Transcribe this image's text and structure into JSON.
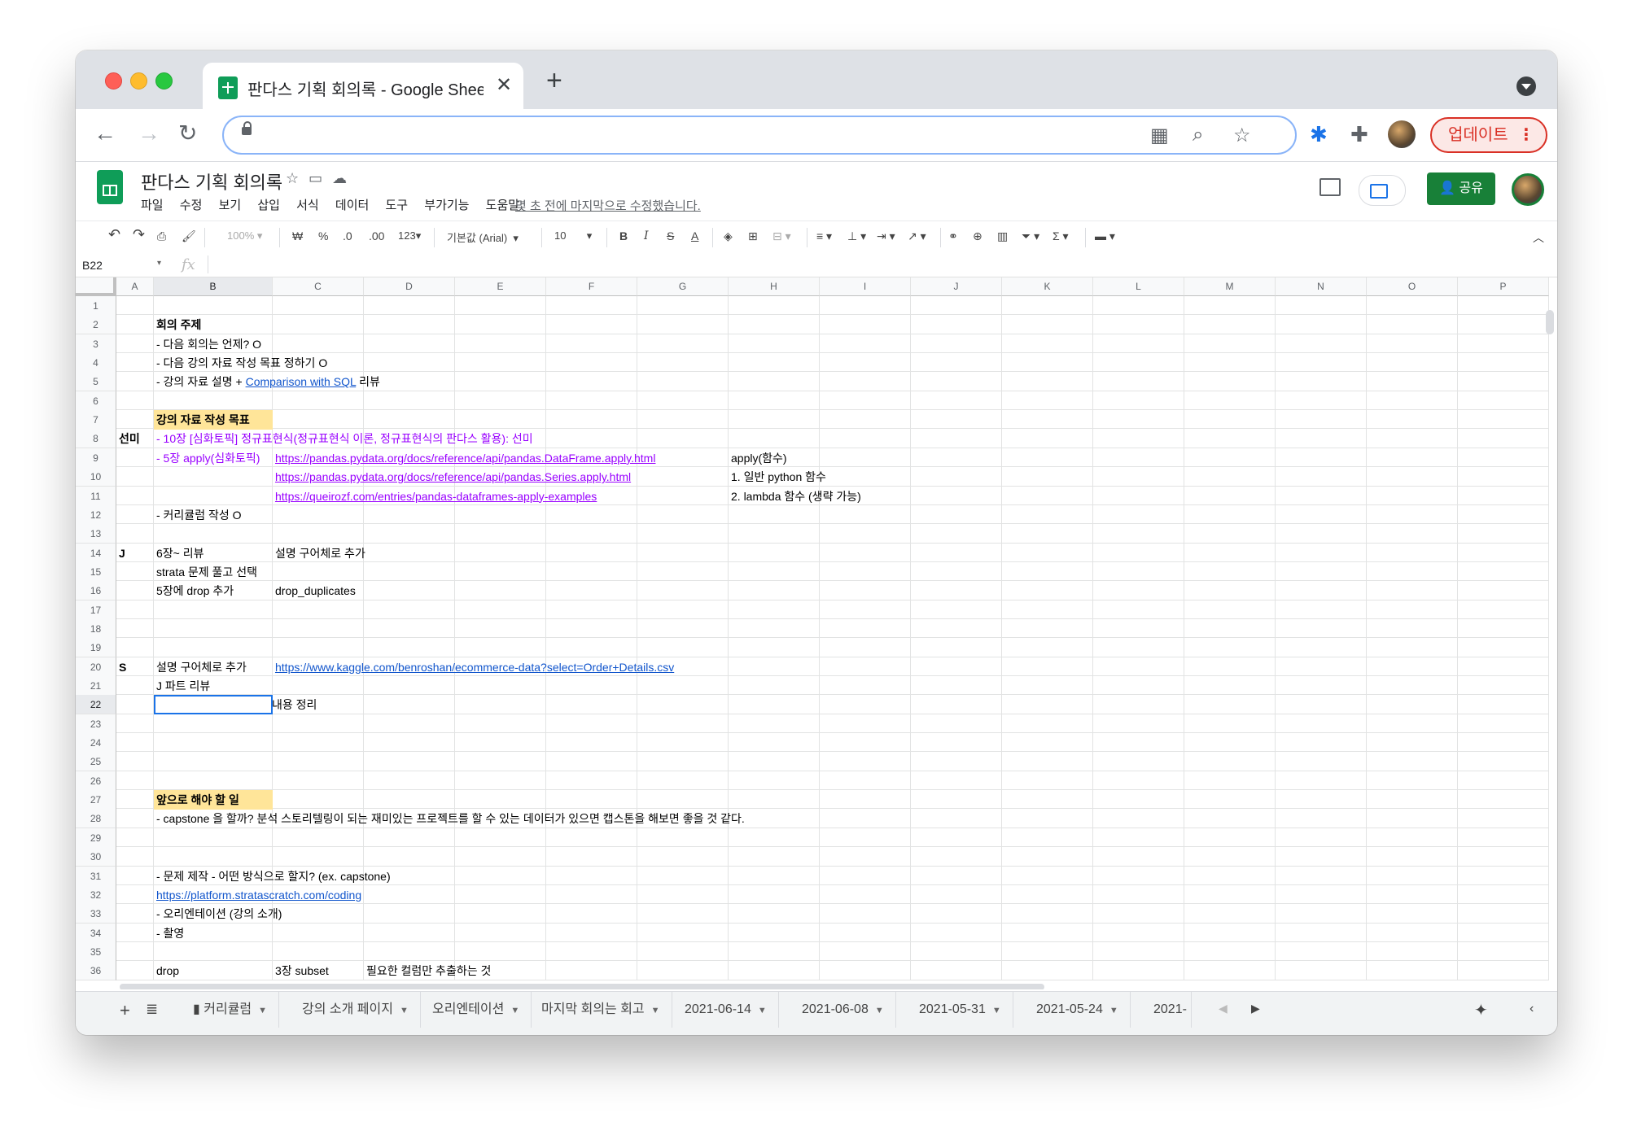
{
  "browser": {
    "tab_title": "판다스 기획 회의록 - Google Sheets",
    "update_label": "업데이트"
  },
  "doc": {
    "title": "판다스 기획 회의록",
    "menu": [
      "파일",
      "수정",
      "보기",
      "삽입",
      "서식",
      "데이터",
      "도구",
      "부가기능",
      "도움말"
    ],
    "last_edit": "몇 초 전에 마지막으로 수정했습니다.",
    "share_label": "공유"
  },
  "toolbar": {
    "zoom": "100%",
    "currency": "₩",
    "percent": "%",
    "dec_less": ".0",
    "dec_more": ".00",
    "format_more": "123",
    "font": "기본값 (Arial)",
    "font_size": "10"
  },
  "formula_bar": {
    "cell_ref": "B22",
    "fx": "fx"
  },
  "columns": [
    "A",
    "B",
    "C",
    "D",
    "E",
    "F",
    "G",
    "H",
    "I",
    "J",
    "K",
    "L",
    "M",
    "N",
    "O",
    "P"
  ],
  "rows": [
    "1",
    "2",
    "3",
    "4",
    "5",
    "6",
    "7",
    "8",
    "9",
    "10",
    "11",
    "12",
    "13",
    "14",
    "15",
    "16",
    "17",
    "18",
    "19",
    "20",
    "21",
    "22",
    "23",
    "24",
    "25",
    "26",
    "27",
    "28",
    "29",
    "30",
    "31",
    "32",
    "33",
    "34",
    "35",
    "36"
  ],
  "cells": {
    "r2_b": "회의 주제",
    "r3_b": "- 다음 회의는 언제? O",
    "r4_b": "- 다음 강의 자료 작성 목표 정하기 O",
    "r5_b_pre": "- 강의 자료 설명 + ",
    "r5_b_link": "Comparison with SQL",
    "r5_b_post": " 리뷰",
    "r7_b": "강의 자료 작성 목표",
    "r8_a": "선미",
    "r8_b": "- 10장 [심화토픽] 정규표현식(정규표현식 이론, 정규표현식의 판다스 활용): 선미",
    "r9_b": "- 5장 apply(심화토픽)",
    "r9_c": "https://pandas.pydata.org/docs/reference/api/pandas.DataFrame.apply.html",
    "r9_h": "apply(함수)",
    "r10_c": "https://pandas.pydata.org/docs/reference/api/pandas.Series.apply.html",
    "r10_h": "1. 일반 python 함수",
    "r11_c": "https://queirozf.com/entries/pandas-dataframes-apply-examples",
    "r11_h": "2. lambda 함수 (생략 가능)",
    "r12_b": "- 커리큘럼 작성 O",
    "r14_a": "J",
    "r14_b": "6장~ 리뷰",
    "r14_c": "설명 구어체로 추가",
    "r15_b": "strata 문제 풀고 선택",
    "r16_b": "5장에 drop 추가",
    "r16_c": "drop_duplicates",
    "r20_a": "S",
    "r20_b": "설명 구어체로 추가",
    "r20_c": "https://www.kaggle.com/benroshan/ecommerce-data?select=Order+Details.csv",
    "r21_b": "J 파트 리뷰",
    "r22_c": "내용 정리",
    "r27_b": "앞으로 해야 할 일",
    "r28_b": "- capstone 을 할까? 분석 스토리텔링이 되는 재미있는 프로젝트를 할 수 있는 데이터가 있으면 캡스톤을 해보면 좋을 것 같다.",
    "r31_b": "- 문제 제작 - 어떤 방식으로 할지? (ex. capstone)",
    "r32_b": "https://platform.stratascratch.com/coding",
    "r33_b": "- 오리엔테이션 (강의 소개)",
    "r34_b": "- 촬영",
    "r36_b": "drop",
    "r36_c": "3장 subset",
    "r36_d": "필요한 컬럼만 추출하는 것"
  },
  "sheet_tabs": [
    "커리큘럼",
    "강의 소개 페이지",
    "오리엔테이션",
    "마지막 회의는 회고",
    "2021-06-14",
    "2021-06-08",
    "2021-05-31",
    "2021-05-24",
    "2021-"
  ]
}
